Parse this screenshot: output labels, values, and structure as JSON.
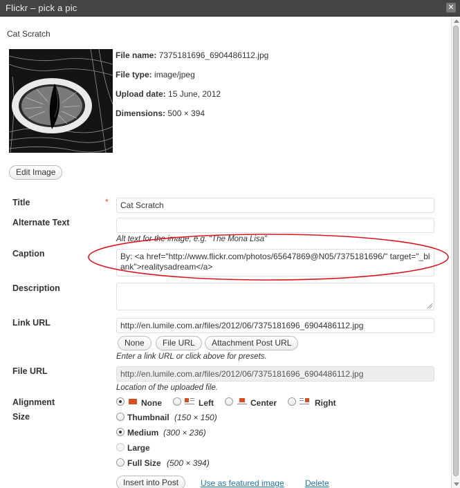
{
  "window": {
    "title": "Flickr – pick a pic",
    "close_label": "✕"
  },
  "post_title": "Cat Scratch",
  "file_info": {
    "file_name_label": "File name:",
    "file_name": "7375181696_6904486112.jpg",
    "file_type_label": "File type:",
    "file_type": "image/jpeg",
    "upload_date_label": "Upload date:",
    "upload_date": "15 June, 2012",
    "dimensions_label": "Dimensions:",
    "dimensions": "500 × 394"
  },
  "edit_image_label": "Edit Image",
  "form": {
    "title_label": "Title",
    "required_mark": "*",
    "title_value": "Cat Scratch",
    "alt_label": "Alternate Text",
    "alt_value": "",
    "alt_help": "Alt text for the image, e.g. “The Mona Lisa”",
    "caption_label": "Caption",
    "caption_value": "By: <a href=\"http://www.flickr.com/photos/65647869@N05/7375181696/\" target=\"_blank\">realitysadream</a>",
    "description_label": "Description",
    "description_value": "",
    "link_url_label": "Link URL",
    "link_url_value": "http://en.lumile.com.ar/files/2012/06/7375181696_6904486112.jpg",
    "link_buttons": [
      "None",
      "File URL",
      "Attachment Post URL"
    ],
    "link_help": "Enter a link URL or click above for presets.",
    "file_url_label": "File URL",
    "file_url_value": "http://en.lumile.com.ar/files/2012/06/7375181696_6904486112.jpg",
    "file_url_help": "Location of the uploaded file.",
    "alignment_label": "Alignment",
    "alignment_options": [
      "None",
      "Left",
      "Center",
      "Right"
    ],
    "alignment_selected": "None",
    "size_label": "Size",
    "size_options": [
      {
        "label": "Thumbnail",
        "dims": "(150 × 150)"
      },
      {
        "label": "Medium",
        "dims": "(300 × 236)"
      },
      {
        "label": "Large",
        "dims": ""
      },
      {
        "label": "Full Size",
        "dims": "(500 × 394)"
      }
    ],
    "size_selected": "Medium"
  },
  "actions": {
    "insert_label": "Insert into Post",
    "featured_label": "Use as featured image",
    "delete_label": "Delete"
  },
  "colors": {
    "annotation": "#d9161d",
    "link": "#21759b",
    "required": "#d54e21",
    "align_icon_accent": "#d54e21"
  },
  "icons": [
    "close-icon",
    "align-none-icon",
    "align-left-icon",
    "align-center-icon",
    "align-right-icon",
    "resize-grip-icon"
  ]
}
